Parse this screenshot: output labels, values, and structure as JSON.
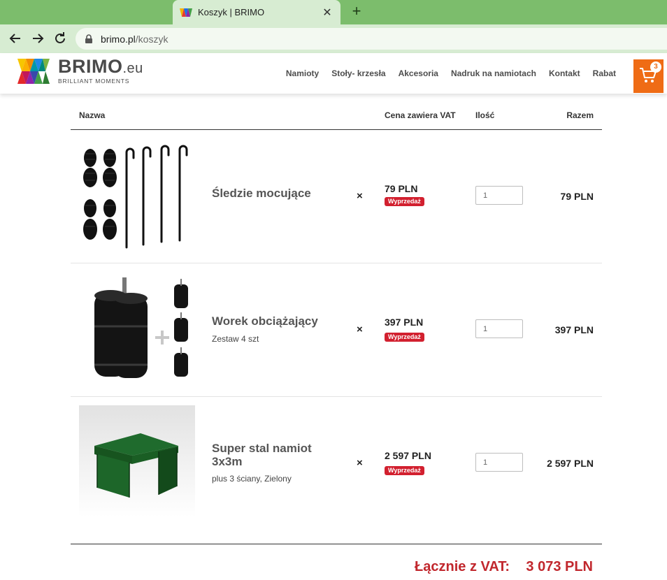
{
  "browser": {
    "tab_title": "Koszyk | BRIMO",
    "url_host": "brimo.pl",
    "url_path": "/koszyk"
  },
  "site": {
    "logo_name": "BRIMO",
    "logo_suffix": ".eu",
    "logo_tagline": "BRILLIANT MOMENTS",
    "nav": [
      {
        "label": "Namioty"
      },
      {
        "label": "Stoły- krzesła"
      },
      {
        "label": "Akcesoria"
      },
      {
        "label": "Nadruk na namiotach"
      },
      {
        "label": "Kontakt"
      },
      {
        "label": "Rabat"
      }
    ],
    "cart_count": "3",
    "accent_color": "#ef6c15"
  },
  "cart": {
    "headers": {
      "name": "Nazwa",
      "price": "Cena zawiera VAT",
      "qty": "Ilość",
      "total": "Razem"
    },
    "items": [
      {
        "name": "Śledzie mocujące",
        "subtitle": "",
        "times": "×",
        "price": "79 PLN",
        "badge": "Wyprzedaż",
        "qty": "1",
        "total": "79 PLN"
      },
      {
        "name": "Worek obciążający",
        "subtitle": "Zestaw 4 szt",
        "times": "×",
        "price": "397 PLN",
        "badge": "Wyprzedaż",
        "qty": "1",
        "total": "397 PLN"
      },
      {
        "name": "Super stal namiot 3x3m",
        "subtitle": "plus 3 ściany, Zielony",
        "times": "×",
        "price": "2 597 PLN",
        "badge": "Wyprzedaż",
        "qty": "1",
        "total": "2 597 PLN"
      }
    ],
    "grand_label": "Łącznie z VAT:",
    "grand_total": "3 073 PLN",
    "sale_color": "#d2202f"
  }
}
